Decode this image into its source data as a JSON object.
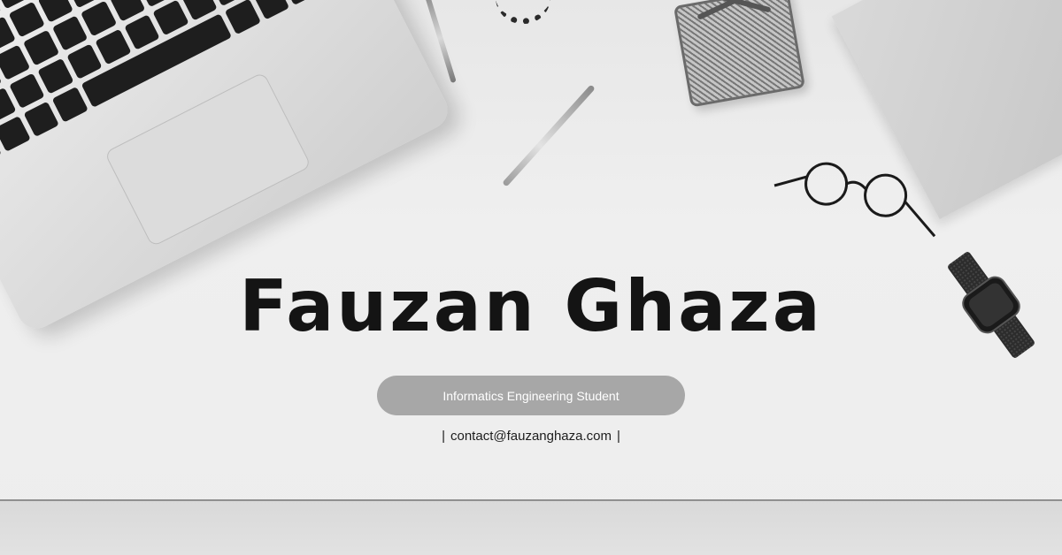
{
  "profile": {
    "name": "Fauzan Ghaza",
    "tagline": "Informatics Engineering Student",
    "contact_prefix": "|",
    "email": "contact@fauzanghaza.com",
    "contact_suffix": "|"
  },
  "colors": {
    "background": "#ececec",
    "name_text": "#141414",
    "pill_background": "#a7a7a7",
    "pill_text": "#ffffff",
    "desk_edge": "#8f8f8f"
  }
}
